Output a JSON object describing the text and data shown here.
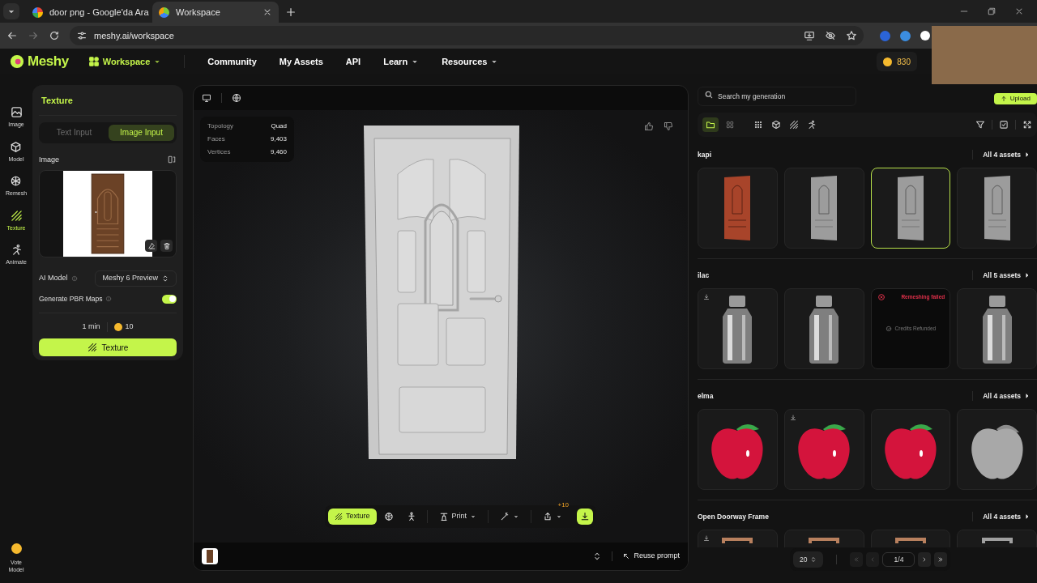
{
  "browser": {
    "tabs": [
      {
        "title": "door png - Google'da Ara",
        "kind": "google",
        "selected": false
      },
      {
        "title": "Workspace",
        "kind": "meshy",
        "selected": true
      }
    ],
    "url": "meshy.ai/workspace"
  },
  "nav": {
    "logo": "Meshy",
    "items": [
      {
        "label": "Workspace",
        "dropdown": true,
        "selected": true
      },
      {
        "label": "Community",
        "dropdown": false,
        "selected": false
      },
      {
        "label": "My Assets",
        "dropdown": false,
        "selected": false
      },
      {
        "label": "API",
        "dropdown": false,
        "selected": false
      },
      {
        "label": "Learn",
        "dropdown": true,
        "selected": false
      },
      {
        "label": "Resources",
        "dropdown": true,
        "selected": false
      }
    ],
    "credits": "830"
  },
  "rail": {
    "items": [
      {
        "label": "Image",
        "kind": "image",
        "selected": false
      },
      {
        "label": "Model",
        "kind": "model",
        "selected": false
      },
      {
        "label": "Remesh",
        "kind": "remesh",
        "selected": false
      },
      {
        "label": "Texture",
        "kind": "texture",
        "selected": true
      },
      {
        "label": "Animate",
        "kind": "animate",
        "selected": false
      }
    ],
    "vote": "Vote Model"
  },
  "panel": {
    "title": "Texture",
    "input_tabs": [
      {
        "label": "Text Input",
        "selected": false
      },
      {
        "label": "Image Input",
        "selected": true
      }
    ],
    "image_label": "Image",
    "ai_model": {
      "label": "AI Model",
      "value": "Meshy 6 Preview"
    },
    "pbr": {
      "label": "Generate PBR Maps",
      "on": true
    },
    "time": "1 min",
    "cost": "10",
    "button": "Texture"
  },
  "viewer": {
    "stats": [
      {
        "label": "Topology",
        "value": "Quad"
      },
      {
        "label": "Faces",
        "value": "9,403"
      },
      {
        "label": "Vertices",
        "value": "9,460"
      }
    ],
    "texture_button": "Texture",
    "print_button": "Print",
    "share_badge": "+10",
    "reuse": "Reuse prompt"
  },
  "library": {
    "search": {
      "placeholder": "Search my generation"
    },
    "upload": "Upload",
    "view_modes": [
      {
        "kind": "folder",
        "selected": true
      },
      {
        "kind": "grid",
        "selected": false
      }
    ],
    "groups": [
      {
        "title": "kapi",
        "link": "All 4 assets",
        "items": [
          {
            "kind": "door-textured",
            "selected": false,
            "download": false
          },
          {
            "kind": "door-gray",
            "selected": false,
            "download": false
          },
          {
            "kind": "door-gray",
            "selected": true,
            "download": false
          },
          {
            "kind": "door-gray",
            "selected": false,
            "download": false
          }
        ]
      },
      {
        "title": "ilac",
        "link": "All 5 assets",
        "items": [
          {
            "kind": "bottle",
            "selected": false,
            "download": true
          },
          {
            "kind": "bottle",
            "selected": false,
            "download": false
          },
          {
            "kind": "failed",
            "selected": false,
            "download": false,
            "error": "Remeshing failed",
            "note": "Credits Refunded"
          },
          {
            "kind": "bottle",
            "selected": false,
            "download": false
          }
        ]
      },
      {
        "title": "elma",
        "link": "All 4 assets",
        "items": [
          {
            "kind": "apple-red",
            "selected": false,
            "download": false
          },
          {
            "kind": "apple-red",
            "selected": false,
            "download": true
          },
          {
            "kind": "apple-red",
            "selected": false,
            "download": false
          },
          {
            "kind": "apple-gray",
            "selected": false,
            "download": false
          }
        ]
      },
      {
        "title": "Open Doorway Frame",
        "link": "All 4 assets",
        "items": [
          {
            "kind": "frame-wood",
            "selected": false,
            "download": true
          },
          {
            "kind": "frame-wood",
            "selected": false,
            "download": false
          },
          {
            "kind": "frame-wood",
            "selected": false,
            "download": false
          },
          {
            "kind": "frame-gray",
            "selected": false,
            "download": false
          }
        ]
      }
    ],
    "pagination": {
      "page_size": "20",
      "page": "1/4"
    }
  }
}
